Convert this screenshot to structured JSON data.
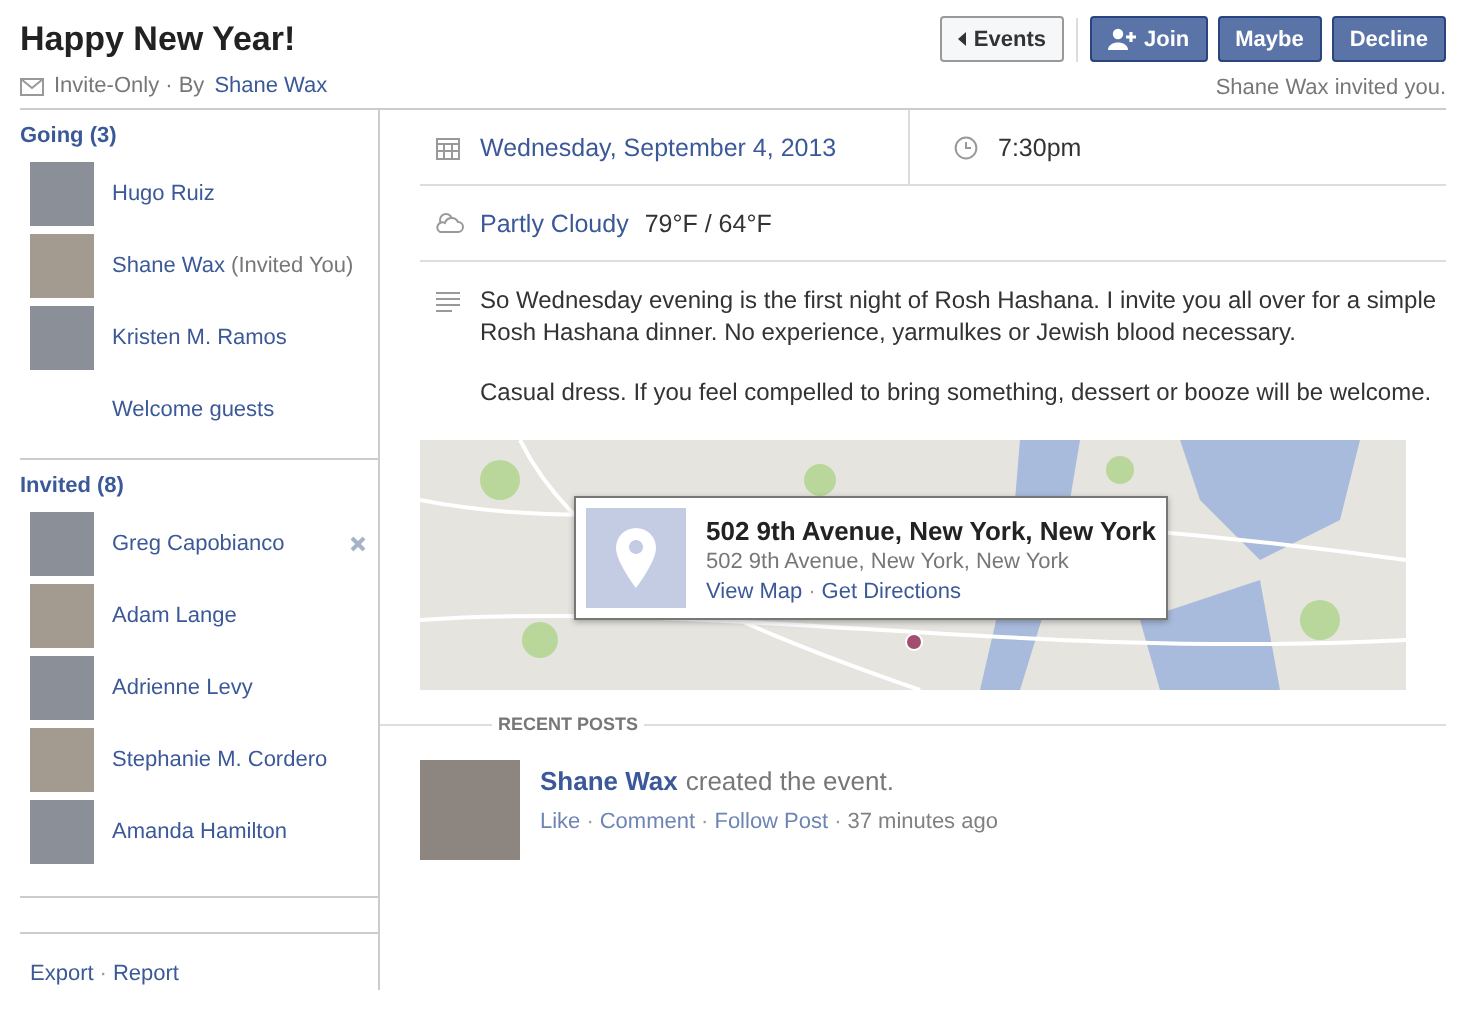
{
  "event": {
    "title": "Happy New Year!",
    "privacy": "Invite-Only · By",
    "host": "Shane Wax"
  },
  "actions": [
    {
      "kind": "back",
      "label": "Events"
    },
    {
      "kind": "join",
      "label": "Join"
    },
    {
      "kind": "primary",
      "label": "Maybe"
    },
    {
      "kind": "primary",
      "label": "Decline"
    }
  ],
  "invite_note": "Shane Wax invited you.",
  "going": {
    "heading": "Going (3)",
    "people": [
      {
        "name": "Hugo Ruiz",
        "removable": false
      },
      {
        "name": "Shane Wax",
        "note": "(Invited You)",
        "removable": false
      },
      {
        "name": "Kristen M. Ramos",
        "removable": false
      }
    ],
    "link": "Welcome guests"
  },
  "invited": {
    "heading": "Invited (8)",
    "people": [
      {
        "name": "Greg Capobianco",
        "removable": true
      },
      {
        "name": "Adam Lange",
        "removable": false
      },
      {
        "name": "Adrienne Levy",
        "removable": false
      },
      {
        "name": "Stephanie M. Cordero",
        "removable": false
      },
      {
        "name": "Amanda Hamilton",
        "removable": false
      }
    ]
  },
  "footer_links": [
    {
      "kind": "link",
      "text": "Export"
    },
    {
      "kind": "sep",
      "text": "·"
    },
    {
      "kind": "link",
      "text": "Report"
    }
  ],
  "details": {
    "date": "Wednesday, September 4, 2013",
    "time": "7:30pm",
    "weather": "Partly Cloudy",
    "temps": "79°F / 64°F",
    "description": [
      "So Wednesday evening is the first night of Rosh Hashana. I invite you all over for a simple Rosh Hashana dinner. No experience, yarmulkes or Jewish blood necessary.",
      "Casual dress. If you feel compelled to bring something, dessert or booze will be welcome."
    ]
  },
  "location": {
    "title": "502 9th Avenue, New York, New York",
    "address": "502 9th Avenue, New York, New York",
    "links": [
      {
        "kind": "link",
        "text": "View Map"
      },
      {
        "kind": "sep",
        "text": "·"
      },
      {
        "kind": "link",
        "text": "Get Directions"
      }
    ]
  },
  "recent_posts": {
    "heading": "RECENT POSTS",
    "posts": [
      {
        "author": "Shane Wax",
        "text": "created the event.",
        "actions": [
          {
            "kind": "link",
            "text": "Like"
          },
          {
            "kind": "sep",
            "text": "·"
          },
          {
            "kind": "link",
            "text": "Comment"
          },
          {
            "kind": "sep",
            "text": "·"
          },
          {
            "kind": "link",
            "text": "Follow Post"
          },
          {
            "kind": "sep",
            "text": "·"
          },
          {
            "kind": "time",
            "text": "37 minutes ago"
          }
        ]
      }
    ]
  }
}
